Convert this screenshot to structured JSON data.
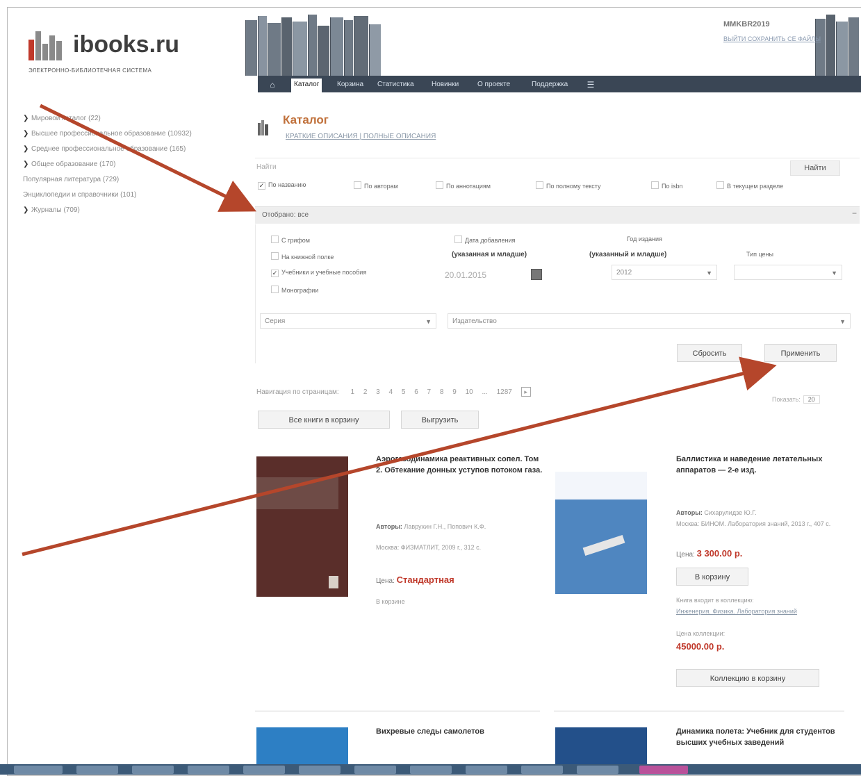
{
  "logo": {
    "name": "ibooks.ru",
    "subtitle": "ЭЛЕКТРОННО-БИБЛИОТЕЧНАЯ СИСТЕМА"
  },
  "user": {
    "name": "MMKBR2019",
    "links": "ВЫЙТИ   СОХРАНИТЬ СЕ ФАЙЛЫ"
  },
  "nav": {
    "items": [
      "Каталог",
      "Корзина",
      "Статистика",
      "Новинки",
      "О проекте",
      "Поддержка"
    ]
  },
  "sidebar": {
    "items": [
      "Мировой каталог (22)",
      "Высшее профессиональное образование (10932)",
      "Среднее профессиональное образование (165)",
      "Общее образование (170)",
      "Популярная литература (729)",
      "Энциклопедии и справочники (101)",
      "Журналы (709)"
    ]
  },
  "catalog": {
    "title": "Каталог",
    "links": "КРАТКИЕ ОПИСАНИЯ | ПОЛНЫЕ ОПИСАНИЯ"
  },
  "search": {
    "placeholder": "Найти",
    "button": "Найти",
    "filters": [
      {
        "label": "По названию",
        "checked": true
      },
      {
        "label": "По авторам",
        "checked": false
      },
      {
        "label": "По аннотациям",
        "checked": false
      },
      {
        "label": "По полному тексту",
        "checked": false
      },
      {
        "label": "По isbn",
        "checked": false
      },
      {
        "label": "В текущем разделе",
        "checked": false
      }
    ]
  },
  "selected": {
    "label": "Отобрано: все",
    "collapse": "−"
  },
  "panel": {
    "types": [
      {
        "label": "С грифом",
        "checked": false
      },
      {
        "label": "На книжной полке",
        "checked": false
      },
      {
        "label": "Учебники и учебные пособия",
        "checked": true
      },
      {
        "label": "Монографии",
        "checked": false
      }
    ],
    "date_added_label": "Дата добавления",
    "date_added_sub": "(указанная и младше)",
    "date_value": "20.01.2015",
    "year_label": "Год издания",
    "year_sub": "(указанный и младше)",
    "year_value": "2012",
    "price_type_label": "Тип цены",
    "series_placeholder": "Серия",
    "publisher_placeholder": "Издательство",
    "reset": "Сбросить",
    "apply": "Применить"
  },
  "pager": {
    "label": "Навигация по страницам:",
    "pages": [
      "1",
      "2",
      "3",
      "4",
      "5",
      "6",
      "7",
      "8",
      "9",
      "10"
    ],
    "ellipsis": "...",
    "last": "1287",
    "next": "▸",
    "per_page_label": "Показать:",
    "per_page_value": "20"
  },
  "actions": {
    "all_to_cart": "Все книги в корзину",
    "export": "Выгрузить"
  },
  "books": [
    {
      "title": "Аэрогазодинамика реактивных сопел. Том 2. Обтекание донных уступов потоком газа.",
      "authors_label": "Авторы:",
      "authors": "Лаврухин Г.Н., Попович К.Ф.",
      "publisher": "Москва: ФИЗМАТЛИТ, 2009 г., 312 с.",
      "price_label": "Цена:",
      "price": "Стандартная",
      "note": "В корзине"
    },
    {
      "title": "Баллистика и наведение летательных аппаратов — 2-е изд.",
      "authors_label": "Авторы:",
      "authors": "Сихарулидзе Ю.Г.",
      "publisher": "Москва: БИНОМ. Лаборатория знаний, 2013 г., 407 с.",
      "price_label": "Цена:",
      "price": "3 300.00 р.",
      "to_cart": "В корзину",
      "collection_note": "Книга входит в коллекцию:",
      "collection_name": "Инженерия. Физика. Лаборатория знаний",
      "collection_price_label": "Цена коллекции:",
      "collection_price": "45000.00 р.",
      "collection_btn": "Коллекцию в корзину"
    },
    {
      "title": "Вихревые следы самолетов"
    },
    {
      "title": "Динамика полета: Учебник для студентов высших учебных заведений"
    }
  ],
  "colors": {
    "nav_bg": "#3a4655",
    "accent": "#c0703a",
    "price": "#c0392b",
    "arrow": "#b5462b"
  }
}
